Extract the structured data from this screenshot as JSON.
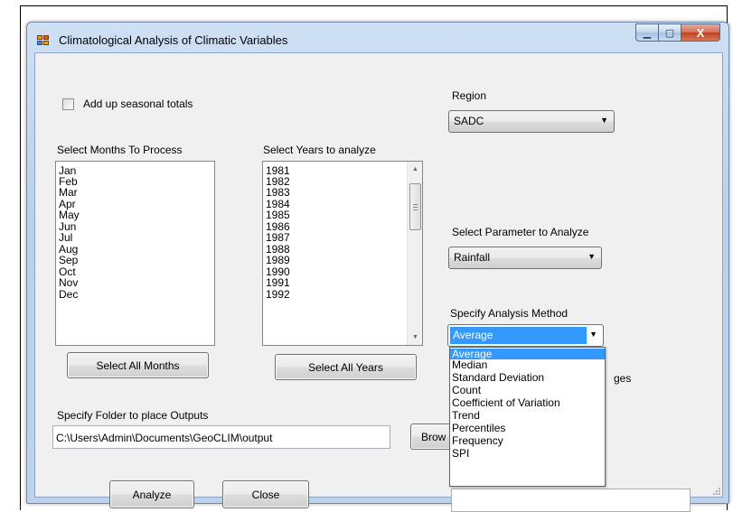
{
  "window": {
    "title": "Climatological Analysis of Climatic Variables"
  },
  "caption_buttons": {
    "minimize": "▁",
    "maximize": "▢",
    "close": "X"
  },
  "seasonal": {
    "label": "Add up seasonal totals",
    "checked": false
  },
  "months": {
    "label": "Select Months To Process",
    "items": [
      "Jan",
      "Feb",
      "Mar",
      "Apr",
      "May",
      "Jun",
      "Jul",
      "Aug",
      "Sep",
      "Oct",
      "Nov",
      "Dec"
    ],
    "select_all": "Select All Months"
  },
  "years": {
    "label": "Select Years to analyze",
    "items": [
      "1981",
      "1982",
      "1983",
      "1984",
      "1985",
      "1986",
      "1987",
      "1988",
      "1989",
      "1990",
      "1991",
      "1992"
    ],
    "select_all": "Select All Years"
  },
  "region": {
    "label": "Region",
    "value": "SADC"
  },
  "parameter": {
    "label": "Select Parameter to Analyze",
    "value": "Rainfall"
  },
  "method": {
    "label": "Specify Analysis Method",
    "value": "Average",
    "options": [
      "Average",
      "Median",
      "Standard Deviation",
      "Count",
      "Coefficient of Variation",
      "Trend",
      "Percentiles",
      "Frequency",
      "SPI"
    ]
  },
  "hidden_label_fragment": "ges",
  "output": {
    "label": "Specify Folder to place Outputs",
    "path": "C:\\Users\\Admin\\Documents\\GeoCLIM\\output",
    "browse": "Brow"
  },
  "actions": {
    "analyze": "Analyze",
    "close": "Close"
  },
  "extra_field": {
    "value": ""
  },
  "colors": {
    "selection": "#3399ff",
    "dialog_bg": "#f0f0f0",
    "frame": "#b9d1ec"
  }
}
